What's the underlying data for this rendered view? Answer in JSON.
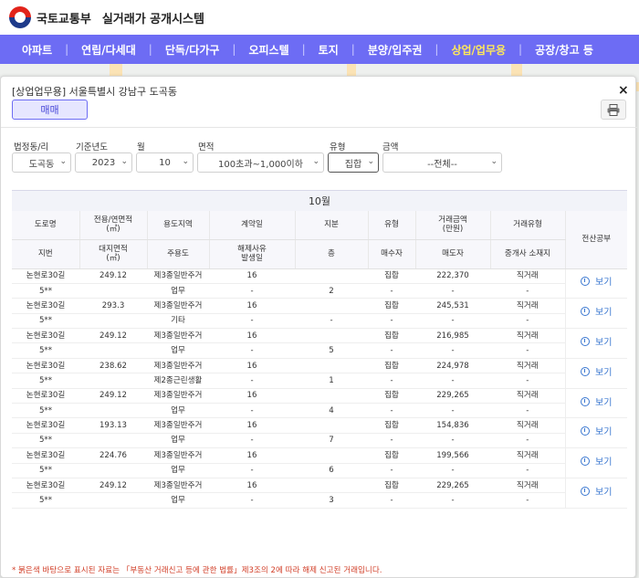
{
  "header": {
    "ministry": "국토교통부",
    "system": "실거래가 공개시스템"
  },
  "nav": [
    {
      "label": "아파트",
      "active": false
    },
    {
      "label": "연립/다세대",
      "active": false
    },
    {
      "label": "단독/다가구",
      "active": false
    },
    {
      "label": "오피스텔",
      "active": false
    },
    {
      "label": "토지",
      "active": false
    },
    {
      "label": "분양/입주권",
      "active": false
    },
    {
      "label": "상업/업무용",
      "active": true
    },
    {
      "label": "공장/창고 등",
      "active": false
    }
  ],
  "modal": {
    "title": "[상업업무용] 서울특별시 강남구 도곡동",
    "tab": "매매",
    "close": "×"
  },
  "filters": {
    "dong": {
      "label": "법정동/리",
      "value": "도곡동"
    },
    "year": {
      "label": "기준년도",
      "value": "2023"
    },
    "month": {
      "label": "월",
      "value": "10"
    },
    "area": {
      "label": "면적",
      "value": "100초과~1,000이하"
    },
    "type": {
      "label": "유형",
      "value": "집합"
    },
    "price": {
      "label": "금액",
      "value": "--전체--"
    }
  },
  "table": {
    "caption": "10월",
    "headers_top": [
      "도로명",
      "전용/연면적\n(㎡)",
      "용도지역",
      "계약일",
      "지분",
      "유형",
      "거래금액\n(만원)",
      "거래유형",
      "전산공부"
    ],
    "headers_bottom": [
      "지번",
      "대지면적\n(㎡)",
      "주용도",
      "해제사유\n발생일",
      "층",
      "매수자",
      "매도자",
      "중개사 소재지"
    ],
    "view_label": "보기",
    "rows": [
      {
        "road": "논현로30길",
        "area": "249.12",
        "zone": "제3종일반주거",
        "date": "16",
        "share": "",
        "type": "집합",
        "price": "222,370",
        "deal": "직거래",
        "lot": "5**",
        "land": "",
        "use": "업무",
        "cancel": "-",
        "floor": "2",
        "buyer": "-",
        "seller": "-",
        "agent": "-"
      },
      {
        "road": "논현로30길",
        "area": "293.3",
        "zone": "제3종일반주거",
        "date": "16",
        "share": "",
        "type": "집합",
        "price": "245,531",
        "deal": "직거래",
        "lot": "5**",
        "land": "",
        "use": "기타",
        "cancel": "-",
        "floor": "-",
        "buyer": "-",
        "seller": "-",
        "agent": "-"
      },
      {
        "road": "논현로30길",
        "area": "249.12",
        "zone": "제3종일반주거",
        "date": "16",
        "share": "",
        "type": "집합",
        "price": "216,985",
        "deal": "직거래",
        "lot": "5**",
        "land": "",
        "use": "업무",
        "cancel": "-",
        "floor": "5",
        "buyer": "-",
        "seller": "-",
        "agent": "-"
      },
      {
        "road": "논현로30길",
        "area": "238.62",
        "zone": "제3종일반주거",
        "date": "16",
        "share": "",
        "type": "집합",
        "price": "224,978",
        "deal": "직거래",
        "lot": "5**",
        "land": "",
        "use": "제2종근린생활",
        "cancel": "-",
        "floor": "1",
        "buyer": "-",
        "seller": "-",
        "agent": "-"
      },
      {
        "road": "논현로30길",
        "area": "249.12",
        "zone": "제3종일반주거",
        "date": "16",
        "share": "",
        "type": "집합",
        "price": "229,265",
        "deal": "직거래",
        "lot": "5**",
        "land": "",
        "use": "업무",
        "cancel": "-",
        "floor": "4",
        "buyer": "-",
        "seller": "-",
        "agent": "-"
      },
      {
        "road": "논현로30길",
        "area": "193.13",
        "zone": "제3종일반주거",
        "date": "16",
        "share": "",
        "type": "집합",
        "price": "154,836",
        "deal": "직거래",
        "lot": "5**",
        "land": "",
        "use": "업무",
        "cancel": "-",
        "floor": "7",
        "buyer": "-",
        "seller": "-",
        "agent": "-"
      },
      {
        "road": "논현로30길",
        "area": "224.76",
        "zone": "제3종일반주거",
        "date": "16",
        "share": "",
        "type": "집합",
        "price": "199,566",
        "deal": "직거래",
        "lot": "5**",
        "land": "",
        "use": "업무",
        "cancel": "-",
        "floor": "6",
        "buyer": "-",
        "seller": "-",
        "agent": "-"
      },
      {
        "road": "논현로30길",
        "area": "249.12",
        "zone": "제3종일반주거",
        "date": "16",
        "share": "",
        "type": "집합",
        "price": "229,265",
        "deal": "직거래",
        "lot": "5**",
        "land": "",
        "use": "업무",
        "cancel": "-",
        "floor": "3",
        "buyer": "-",
        "seller": "-",
        "agent": "-"
      }
    ]
  },
  "footnote": "* 붉은색 바탕으로 표시된 자료는 「부동산 거래신고 등에 관한 법률」제3조의 2에 따라 해제 신고된 거래입니다."
}
